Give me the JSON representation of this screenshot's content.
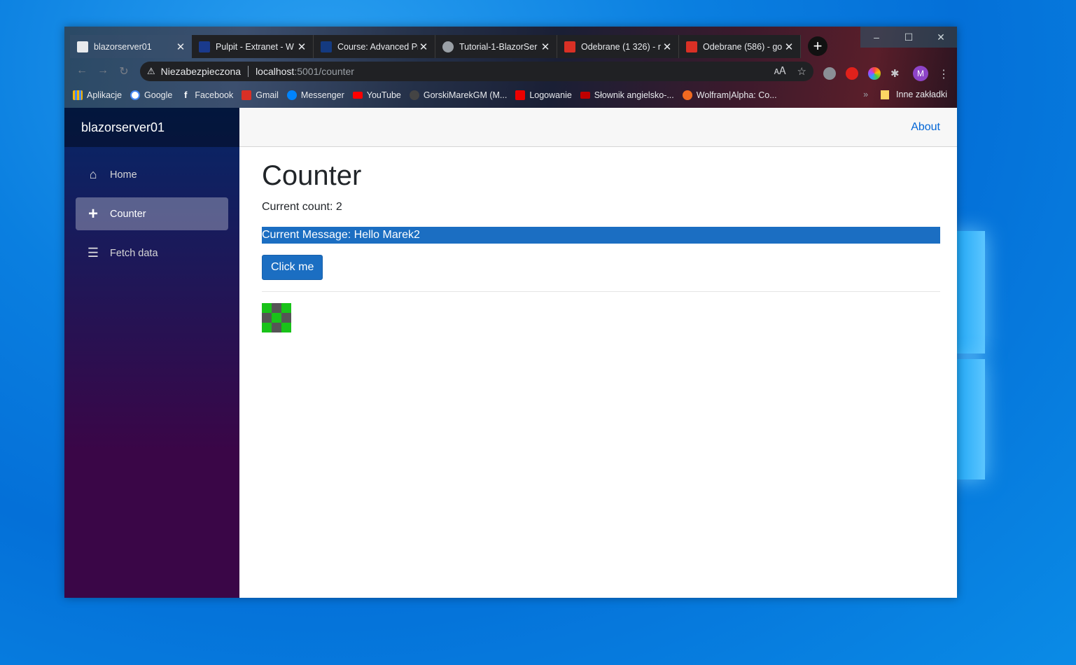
{
  "browser": {
    "tabs": [
      {
        "label": "blazorserver01",
        "active": true,
        "icon": "page-icon"
      },
      {
        "label": "Pulpit - Extranet - W",
        "active": false,
        "icon": "wsb-icon"
      },
      {
        "label": "Course: Advanced Pr",
        "active": false,
        "icon": "wsb-course-icon"
      },
      {
        "label": "Tutorial-1-BlazorSer",
        "active": false,
        "icon": "globe-icon"
      },
      {
        "label": "Odebrane (1 326) - r",
        "active": false,
        "icon": "gmail-icon"
      },
      {
        "label": "Odebrane (586) - go",
        "active": false,
        "icon": "gmail-icon"
      }
    ],
    "address": {
      "security_label": "Niezabezpieczona",
      "host": "localhost",
      "path": ":5001/counter"
    },
    "avatar_letter": "M",
    "bookmarks": [
      {
        "label": "Aplikacje",
        "icon": "apps-icon",
        "color": "#f4b400"
      },
      {
        "label": "Google",
        "icon": "google-icon",
        "color": "#4285f4"
      },
      {
        "label": "Facebook",
        "icon": "facebook-icon",
        "color": "#1877f2"
      },
      {
        "label": "Gmail",
        "icon": "gmail-icon",
        "color": "#d93025"
      },
      {
        "label": "Messenger",
        "icon": "messenger-icon",
        "color": "#0084ff"
      },
      {
        "label": "YouTube",
        "icon": "youtube-icon",
        "color": "#ff0000"
      },
      {
        "label": "GorskiMarekGM (M...",
        "icon": "github-icon",
        "color": "#444444"
      },
      {
        "label": "Logowanie",
        "icon": "santander-icon",
        "color": "#ec0000"
      },
      {
        "label": "Słownik angielsko-...",
        "icon": "diki-icon",
        "color": "#c00000"
      },
      {
        "label": "Wolfram|Alpha: Co...",
        "icon": "wolfram-icon",
        "color": "#f06a21"
      }
    ],
    "other_bookmarks": "Inne zakładki"
  },
  "app": {
    "brand": "blazorserver01",
    "nav": [
      {
        "label": "Home",
        "icon": "home-icon",
        "active": false
      },
      {
        "label": "Counter",
        "icon": "plus-icon",
        "active": true
      },
      {
        "label": "Fetch data",
        "icon": "list-icon",
        "active": false
      }
    ],
    "top_link": "About",
    "page_title": "Counter",
    "current_count": "Current count: 2",
    "current_message": "Current Message: Hello Marek2",
    "button_label": "Click me",
    "accent_color": "#1b6ec2",
    "grid_pattern": [
      "green",
      "gray",
      "green",
      "gray",
      "green",
      "gray",
      "green",
      "gray",
      "green"
    ]
  }
}
